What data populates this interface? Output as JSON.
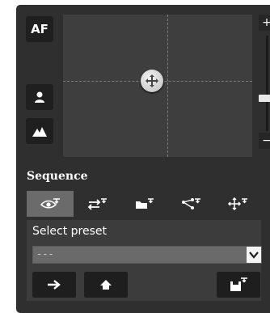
{
  "controls": {
    "af_label": "AF",
    "icons": [
      "person-icon",
      "mountain-icon"
    ]
  },
  "zoom": {
    "plus": "+",
    "minus": "−",
    "level": 0.33
  },
  "sequence": {
    "title": "Sequence",
    "tabs": [
      {
        "name": "tab-eye",
        "icon": "eye-icon",
        "active": true
      },
      {
        "name": "tab-swap",
        "icon": "swap-arrows-icon",
        "active": false
      },
      {
        "name": "tab-folder",
        "icon": "folder-icon",
        "active": false
      },
      {
        "name": "tab-share",
        "icon": "share-nodes-icon",
        "active": false
      },
      {
        "name": "tab-move",
        "icon": "move-arrows-icon",
        "active": false
      }
    ]
  },
  "preset": {
    "label": "Select preset",
    "selected": "---",
    "buttons": [
      "go-arrow-icon",
      "home-icon",
      "save-preset-icon"
    ]
  },
  "colors": {
    "panel": "#2f2f2f",
    "area": "#3e3e3e",
    "active_tab": "#6b6b6b",
    "select": "#6a6a6a"
  }
}
